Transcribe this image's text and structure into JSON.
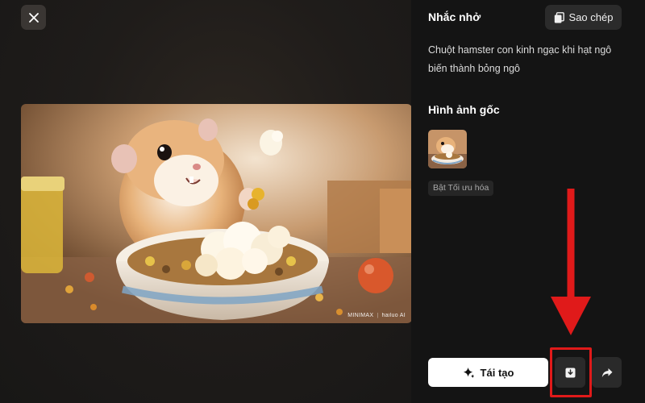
{
  "prompt": {
    "title": "Nhắc nhở",
    "copy_label": "Sao chép",
    "text": "Chuột hamster con kinh ngạc khi hạt ngô biến thành bỏng ngô"
  },
  "original": {
    "title": "Hình ảnh gốc",
    "badge": "Bật Tối ưu hóa"
  },
  "preview": {
    "watermark_left": "MINIMAX",
    "watermark_right": "hailuo AI"
  },
  "actions": {
    "regenerate_label": "Tái tạo"
  },
  "icons": {
    "close": "close-icon",
    "copy": "copy-icon",
    "regenerate": "sparkle-icon",
    "download": "download-icon",
    "share": "share-icon"
  },
  "colors": {
    "annotation": "#e01a1a",
    "panel_bg": "#141414",
    "primary_button": "#ffffff"
  }
}
